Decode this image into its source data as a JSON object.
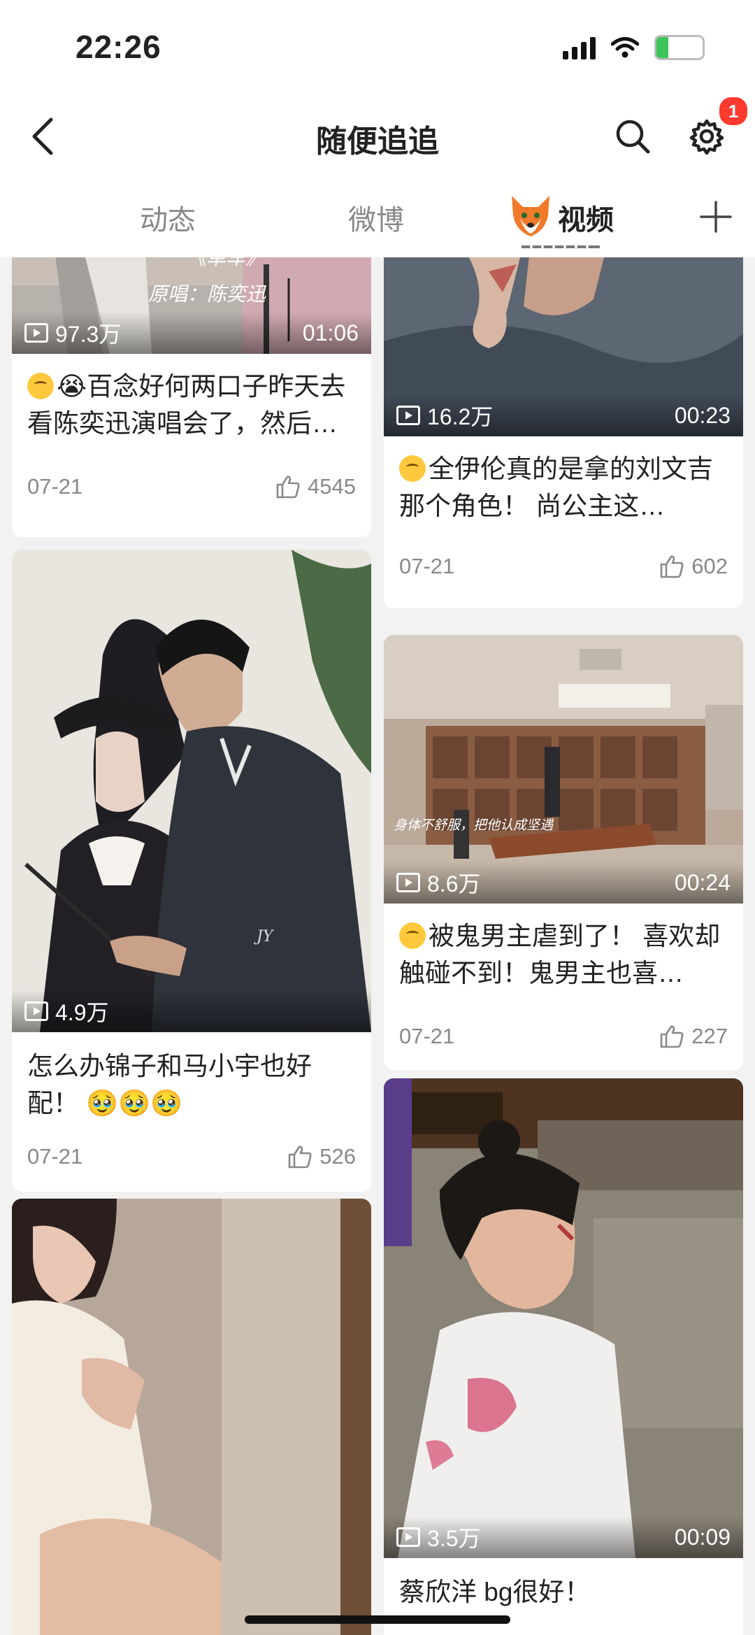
{
  "status_bar": {
    "time": "22:26",
    "battery": "26",
    "battery_level": 0.26
  },
  "navbar": {
    "title": "随便追追",
    "badge_count": "1"
  },
  "tabs": [
    {
      "label": "动态",
      "active": false
    },
    {
      "label": "微博",
      "active": false
    },
    {
      "label": "视频",
      "active": true
    }
  ],
  "cards": [
    {
      "views": "97.3万",
      "duration": "01:06",
      "title": "😭百念好何两口子昨天去看陈奕迅演唱会了，然后…",
      "date": "07-21",
      "likes": "4545",
      "thumb_text": "《单车》 原唱：陈奕迅"
    },
    {
      "views": "16.2万",
      "duration": "00:23",
      "title": "全伊伦真的是拿的刘文吉那个角色！ 尚公主这…",
      "date": "07-21",
      "likes": "602"
    },
    {
      "views": "4.9万",
      "duration": "",
      "title": "怎么办锦子和马小宇也好配！ 🥹🥹🥹",
      "date": "07-21",
      "likes": "526",
      "thumb_text": "JY"
    },
    {
      "views": "8.6万",
      "duration": "00:24",
      "title": "被鬼男主虐到了！ 喜欢却触碰不到！鬼男主也喜…",
      "date": "07-21",
      "likes": "227",
      "thumb_text": "身体不舒服，把他认成坚遇"
    },
    {
      "views": "",
      "duration": "",
      "title": "",
      "date": "",
      "likes": ""
    },
    {
      "views": "3.5万",
      "duration": "00:09",
      "title": "蔡欣洋 bg很好！",
      "date": "",
      "likes": ""
    }
  ],
  "icons": [
    "back-icon",
    "search-icon",
    "gear-icon",
    "fox-avatar-icon",
    "plus-icon",
    "play-icon",
    "thumbs-up-icon",
    "crying-emoji-icon",
    "scream-emoji-icon"
  ],
  "colors": {
    "badge": "#ff3b30",
    "battery": "#3bc55a",
    "accent_text": "#222222",
    "muted_text": "#888888"
  }
}
